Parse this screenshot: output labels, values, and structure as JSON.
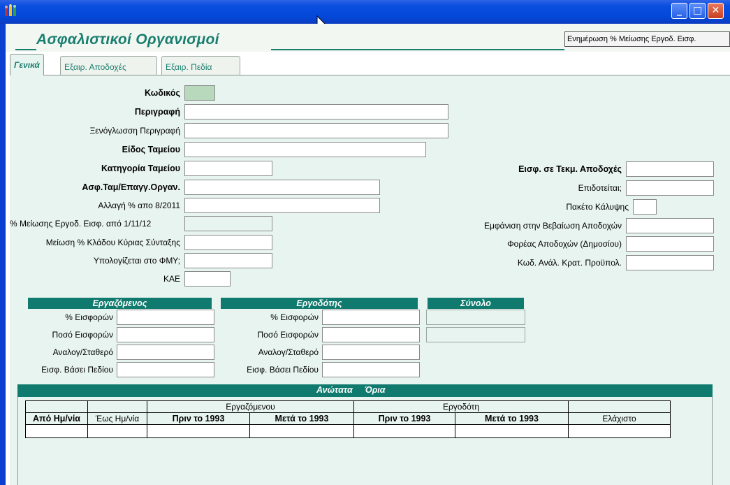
{
  "window": {
    "title": "",
    "controls": {
      "minimize": "_",
      "maximize": "□",
      "close": "✕"
    }
  },
  "header": {
    "title": "Ασφαλιστικοί Οργανισμοί",
    "update_button": "Ενημέρωση % Μείωσης Εργοδ. Εισφ."
  },
  "tabs": [
    {
      "label": "Γενικά",
      "active": true
    },
    {
      "label": "Εξαιρ. Αποδοχές",
      "active": false
    },
    {
      "label": "Εξαιρ. Πεδία",
      "active": false
    }
  ],
  "form_left": [
    {
      "label": "Κωδικός",
      "bold": true,
      "value": ""
    },
    {
      "label": "Περιγραφή",
      "bold": true,
      "value": ""
    },
    {
      "label": "Ξενόγλωσση Περιγραφή",
      "bold": false,
      "value": ""
    },
    {
      "label": "Είδος Ταμείου",
      "bold": true,
      "value": ""
    },
    {
      "label": "Κατηγορία Ταμείου",
      "bold": true,
      "value": ""
    },
    {
      "label": "Ασφ.Ταμ/Επαγγ.Οργαν.",
      "bold": true,
      "value": ""
    },
    {
      "label": "Αλλαγή % απο 8/2011",
      "bold": false,
      "value": ""
    },
    {
      "label": "% Μείωσης Εργοδ. Εισφ. από 1/11/12",
      "bold": false,
      "value": ""
    },
    {
      "label": "Μείωση % Κλάδου Κύριας Σύνταξης",
      "bold": false,
      "value": ""
    },
    {
      "label": "Υπολογίζεται στο ΦΜΥ;",
      "bold": false,
      "value": ""
    },
    {
      "label": "ΚΑΕ",
      "bold": false,
      "value": ""
    }
  ],
  "form_right": [
    {
      "label": "Εισφ. σε Τεκμ. Αποδοχές",
      "bold": true,
      "value": ""
    },
    {
      "label": "Επιδοτείται;",
      "bold": false,
      "value": ""
    },
    {
      "label": "Πακέτο Κάλυψης",
      "bold": false,
      "value": ""
    },
    {
      "label": "Εμφάνιση στην Βεβαίωση Αποδοχών",
      "bold": false,
      "value": ""
    },
    {
      "label": "Φορέας Αποδοχών (Δημοσίου)",
      "bold": false,
      "value": ""
    },
    {
      "label": "Κωδ. Ανάλ. Κρατ. Προϋπολ.",
      "bold": false,
      "value": ""
    }
  ],
  "employee": {
    "title": "Εργαζόμενος",
    "fields": [
      "% Εισφορών",
      "Ποσό Εισφορών",
      "Αναλογ/Σταθερό",
      "Εισφ. Βάσει Πεδίου"
    ]
  },
  "employer": {
    "title": "Εργοδότης",
    "fields": [
      "% Εισφορών",
      "Ποσό Εισφορών",
      "Αναλογ/Σταθερό",
      "Εισφ. Βάσει Πεδίου"
    ]
  },
  "total": {
    "title": "Σύνολο"
  },
  "limits": {
    "title": "Ανώτατα     Όρια",
    "group_employee": "Εργαζόμενου",
    "group_employer": "Εργοδότη",
    "columns": [
      "Από Ημ/νία",
      "Έως Ημ/νία",
      "Πριν το 1993",
      "Μετά το 1993",
      "Πριν το 1993",
      "Μετά το 1993",
      "Ελάχιστο"
    ]
  }
}
